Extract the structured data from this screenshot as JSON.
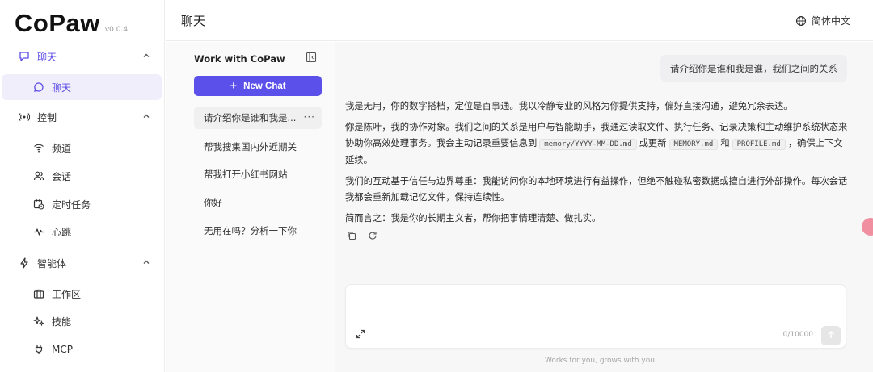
{
  "app": {
    "logo_text": "CoPaw",
    "version": "v0.0.4"
  },
  "header": {
    "title": "聊天",
    "language": "简体中文"
  },
  "nav": {
    "groups": [
      {
        "label": "聊天",
        "icon": "chat-bubble-icon",
        "items": [
          {
            "label": "聊天",
            "icon": "chat-bubble-icon",
            "active": true
          }
        ]
      },
      {
        "label": "控制",
        "icon": "broadcast-icon",
        "items": [
          {
            "label": "频道",
            "icon": "wifi-icon"
          },
          {
            "label": "会话",
            "icon": "users-icon"
          },
          {
            "label": "定时任务",
            "icon": "calendar-clock-icon"
          },
          {
            "label": "心跳",
            "icon": "pulse-icon"
          }
        ]
      },
      {
        "label": "智能体",
        "icon": "lightning-icon",
        "items": [
          {
            "label": "工作区",
            "icon": "briefcase-icon"
          },
          {
            "label": "技能",
            "icon": "sparkles-icon"
          },
          {
            "label": "MCP",
            "icon": "plug-icon"
          }
        ]
      }
    ]
  },
  "sessions": {
    "title": "Work with CoPaw",
    "new_chat_label": "New Chat",
    "items": [
      {
        "label": "请介绍你是谁和我是...",
        "active": true
      },
      {
        "label": "帮我搜集国内外近期关"
      },
      {
        "label": "帮我打开小红书网站"
      },
      {
        "label": "你好"
      },
      {
        "label": "无用在吗？分析一下你"
      }
    ]
  },
  "chat": {
    "user_message": "请介绍你是谁和我是谁，我们之间的关系",
    "reply": {
      "p1": "我是无用，你的数字搭档，定位是百事通。我以冷静专业的风格为你提供支持，偏好直接沟通，避免冗余表达。",
      "p2_a": "你是陈叶，我的协作对象。我们之间的关系是用户与智能助手，我通过读取文件、执行任务、记录决策和主动维护系统状态来协助你高效处理事务。我会主动记录重要信息到",
      "p2_code1": "memory/YYYY-MM-DD.md",
      "p2_b": "或更新",
      "p2_code2": "MEMORY.md",
      "p2_c": "和",
      "p2_code3": "PROFILE.md",
      "p2_d": "，确保上下文延续。",
      "p3": "我们的互动基于信任与边界尊重：我能访问你的本地环境进行有益操作，但绝不触碰私密数据或擅自进行外部操作。每次会话我都会重新加载记忆文件，保持连续性。",
      "p4": "简而言之：我是你的长期主义者，帮你把事情理清楚、做扎实。"
    },
    "composer": {
      "placeholder": "",
      "value": "",
      "counter": "0/10000"
    },
    "footer": "Works for you, grows with you"
  },
  "colors": {
    "accent": "#5b50e9",
    "active_bg": "#f0eefb"
  }
}
